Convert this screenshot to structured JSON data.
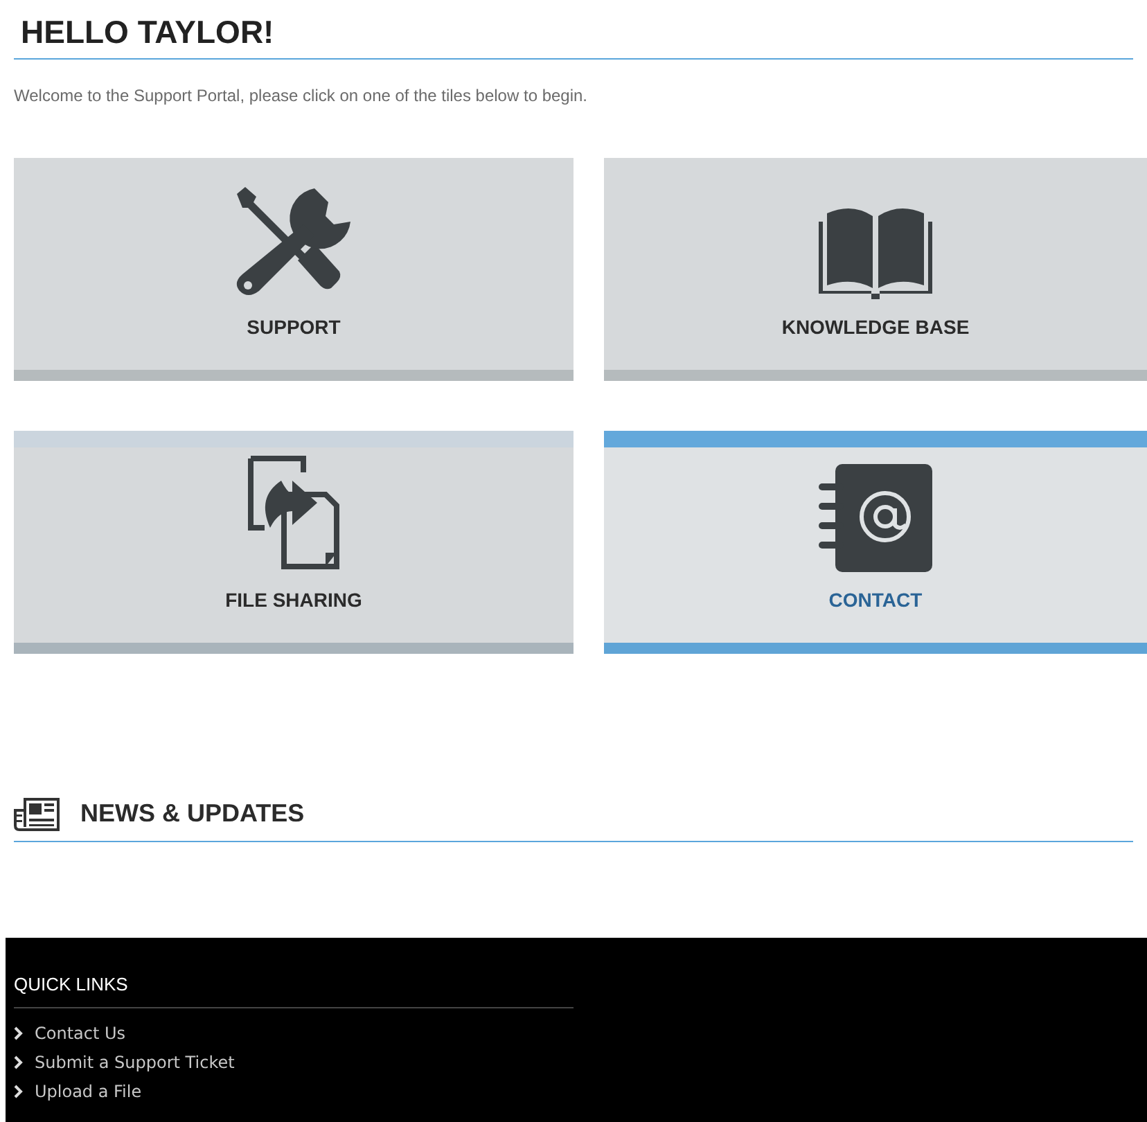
{
  "greeting": "HELLO TAYLOR!",
  "intro": "Welcome to the Support Portal, please click on one of the tiles below to begin.",
  "tiles": [
    {
      "kind": "tools",
      "label": "SUPPORT",
      "selected": false,
      "hovered": false
    },
    {
      "kind": "book",
      "label": "KNOWLEDGE BASE",
      "selected": false,
      "hovered": false
    },
    {
      "kind": "files",
      "label": "FILE SHARING",
      "selected": false,
      "hovered": true
    },
    {
      "kind": "contact",
      "label": "CONTACT",
      "selected": true,
      "hovered": false
    }
  ],
  "news": {
    "title": "NEWS & UPDATES"
  },
  "footer": {
    "title": "QUICK LINKS",
    "links": [
      "Contact Us",
      "Submit a Support Ticket",
      "Upload a File"
    ]
  }
}
